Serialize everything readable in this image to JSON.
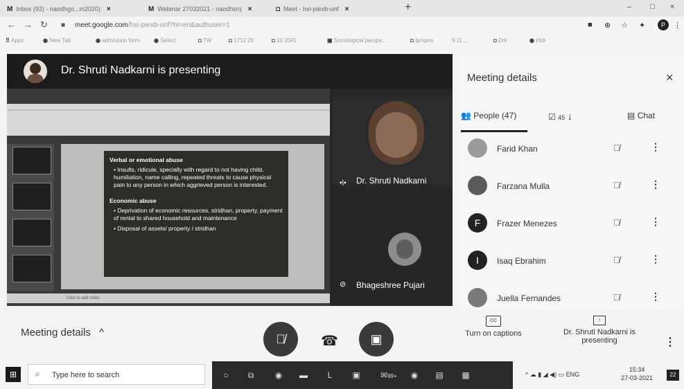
{
  "browser": {
    "tabs": [
      {
        "favicon": "M",
        "label": "Inbox (93) - naodhgo...m2020)",
        "close": "×"
      },
      {
        "favicon": "M",
        "label": "Webinar 27032021 - naodhsn)",
        "close": "×"
      },
      {
        "favicon": "◘",
        "label": "Meet - hxi-piexb-unf",
        "close": "×"
      }
    ],
    "new_tab": "+",
    "window": {
      "minimize": "–",
      "maximize": "□",
      "close": "×"
    },
    "url_host": "meet.google.com",
    "url_rest": "/hxi-piexb-unf?hl=en&authuser=1",
    "profile_initial": "P",
    "bookmarks": [
      "Apps",
      "New Tab",
      "admission form",
      "Select",
      "TW",
      "1712 26",
      "10 2041",
      "Sociological perspe...",
      "Ipmpns",
      "9.11 ...",
      "Dril",
      "Hidi"
    ]
  },
  "meet": {
    "presenter_banner": "Dr. Shruti Nadkarni is presenting",
    "slide": {
      "heading1": "Verbal or emotional abuse",
      "item1": "• Insults, ridicule, specially with regard to not having child, humiliation, name calling, repeated threats to cause physical pain to any person in which aggrieved person is interested.",
      "heading2": "Economic abuse",
      "item2": "• Deprivation of economic resources, stridhan, property, payment of rental to shared household and maintenance",
      "item3": "• Disposal of assets/ property / stridhan",
      "notes_hint": "Click to add notes"
    },
    "tiles": [
      {
        "name": "Dr. Shruti Nadkarni",
        "icon": "speaking-icon"
      },
      {
        "name": "Bhageshree Pujari",
        "icon": "mic-off-icon"
      }
    ],
    "bottom": {
      "meeting_details": "Meeting details",
      "meeting_details_chevron": "^",
      "captions_label": "Turn on captions",
      "captions_icon": "CC",
      "presenting_label": "Dr. Shruti Nadkarni is presenting"
    }
  },
  "panel": {
    "title": "Meeting details",
    "close": "×",
    "people_tab": "People (47)",
    "tasks_count": "45",
    "chat_tab": "Chat",
    "people": [
      {
        "name": "Farid Khan",
        "initial": ""
      },
      {
        "name": "Farzana Mulla",
        "initial": ""
      },
      {
        "name": "Frazer Menezes",
        "initial": "F"
      },
      {
        "name": "Isaq Ebrahim",
        "initial": "I"
      },
      {
        "name": "Juella Fernandes",
        "initial": ""
      }
    ]
  },
  "taskbar": {
    "search_placeholder": "Type here to search",
    "app_badge": "99+",
    "lang": "ENG",
    "time": "15:34",
    "date": "27-03-2021",
    "notifications": "22"
  }
}
